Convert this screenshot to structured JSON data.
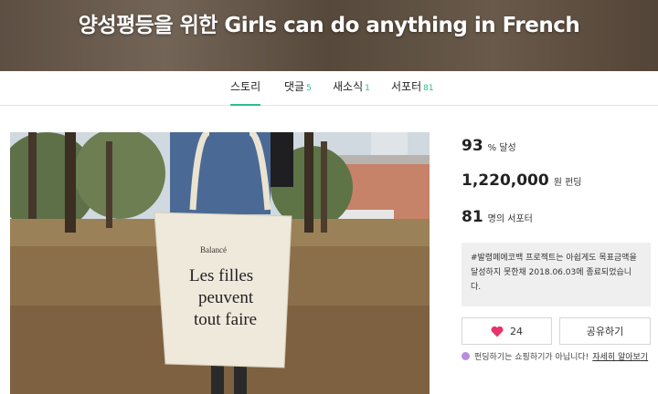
{
  "project": {
    "title": "양성평등을 위한 Girls can do anything in French"
  },
  "tabs": [
    {
      "label": "스토리",
      "count": ""
    },
    {
      "label": "댓글",
      "count": "5"
    },
    {
      "label": "새소식",
      "count": "1"
    },
    {
      "label": "서포터",
      "count": "81"
    }
  ],
  "photo": {
    "bag_brand": "Balancé",
    "bag_line1": "Les filles",
    "bag_line2": "peuvent",
    "bag_line3": "tout faire"
  },
  "stats": {
    "percent_value": "93",
    "percent_label": "% 달성",
    "amount_value": "1,220,000",
    "amount_label": "원 펀딩",
    "supporters_value": "81",
    "supporters_label": "명의 서포터"
  },
  "notice": {
    "text": "#발령페에코백 프로젝트는 아쉽게도 목표금액을 달성하지 못한채 2018.06.03에 종료되었습니다."
  },
  "actions": {
    "like_count": "24",
    "share_label": "공유하기"
  },
  "footnote": {
    "text": "펀딩하기는 쇼핑하기가 아닙니다!",
    "link": "자세히 알아보기"
  },
  "colors": {
    "accent": "#2bbf8e",
    "like": "#e8336b",
    "notice_bg": "#efefef"
  }
}
